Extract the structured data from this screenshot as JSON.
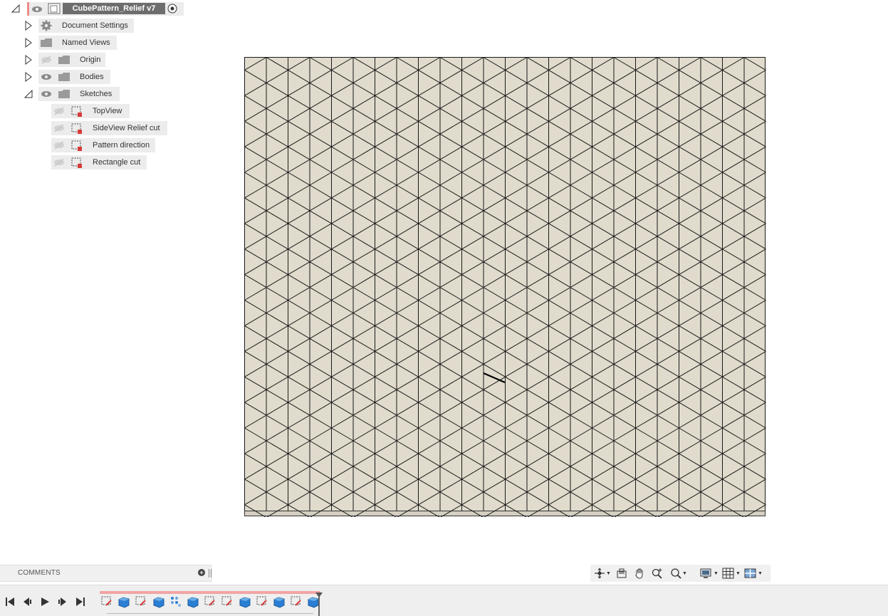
{
  "browser": {
    "root": {
      "title": "CubePattern_Relief v7"
    },
    "nodes": [
      {
        "label": "Document Settings"
      },
      {
        "label": "Named Views"
      },
      {
        "label": "Origin"
      },
      {
        "label": "Bodies"
      },
      {
        "label": "Sketches"
      }
    ],
    "sketches": [
      {
        "label": "TopView"
      },
      {
        "label": "SideView Relief cut"
      },
      {
        "label": "Pattern direction"
      },
      {
        "label": "Rectangle cut"
      }
    ]
  },
  "canvas": {
    "model_fill": "#e0dbcc",
    "edge_color": "#1a1a1a",
    "pattern": "isometric-cube-relief"
  },
  "comments": {
    "label": "COMMENTS"
  },
  "navbar": {
    "tools": [
      "orbit-icon",
      "look-at-icon",
      "pan-icon",
      "zoom-icon",
      "fit-icon",
      "display-settings-icon",
      "grid-settings-icon",
      "viewports-icon"
    ]
  },
  "timeline": {
    "controls": [
      "go-to-start-icon",
      "step-back-icon",
      "play-icon",
      "step-forward-icon",
      "go-to-end-icon"
    ],
    "features": [
      "sketch",
      "extrude",
      "sketch",
      "extrude",
      "pattern",
      "extrude",
      "sketch",
      "sketch",
      "extrude",
      "sketch",
      "extrude",
      "sketch",
      "extrude"
    ]
  },
  "colors": {
    "accent_red": "#f08b8b",
    "sketch_red": "#d83a3a",
    "body_blue": "#2a7fd4",
    "panel_bg": "#ececec"
  }
}
